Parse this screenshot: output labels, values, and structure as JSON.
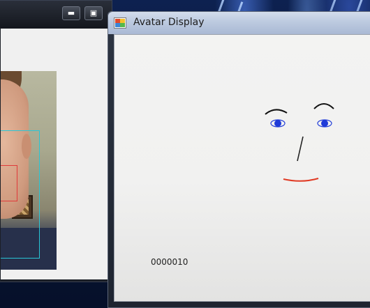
{
  "desktop": {
    "wallpaper_color": "#0a1630"
  },
  "camera_window": {
    "buttons": {
      "minimize_icon": "minimize-icon",
      "maximize_icon": "maximize-icon"
    },
    "detection_colors": {
      "face_box": "#29c6d6",
      "eye_box": "#e03a3a"
    }
  },
  "avatar_window": {
    "title": "Avatar Display",
    "icon": "app-icon",
    "counter": "0000010",
    "avatar_colors": {
      "eyebrows": "#111111",
      "eyes": "#1f3bd8",
      "nose": "#222222",
      "mouth": "#e03a24"
    }
  }
}
